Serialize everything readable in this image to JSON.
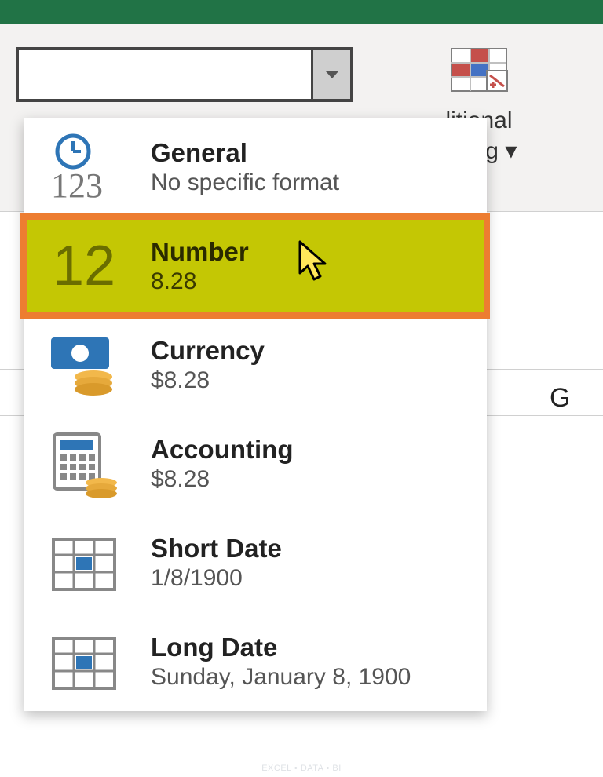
{
  "topbar": {
    "title_fragment": ""
  },
  "ribbon": {
    "format_selector_value": "",
    "conditional_formatting_line1": "litional",
    "conditional_formatting_line2": "atting"
  },
  "sheet": {
    "column_letter_g": "G"
  },
  "dropdown": {
    "items": [
      {
        "id": "general",
        "title": "General",
        "sub": "No specific format",
        "icon": "clock-123"
      },
      {
        "id": "number",
        "title": "Number",
        "sub": "8.28",
        "icon": "twelve",
        "highlight": true
      },
      {
        "id": "currency",
        "title": "Currency",
        "sub": "$8.28",
        "icon": "money"
      },
      {
        "id": "accounting",
        "title": "Accounting",
        "sub": " $8.28",
        "icon": "calculator"
      },
      {
        "id": "short-date",
        "title": "Short Date",
        "sub": "1/8/1900",
        "icon": "calendar"
      },
      {
        "id": "long-date",
        "title": "Long Date",
        "sub": "Sunday, January 8, 1900",
        "icon": "calendar"
      }
    ]
  },
  "watermark": "EXCEL • DATA • BI"
}
